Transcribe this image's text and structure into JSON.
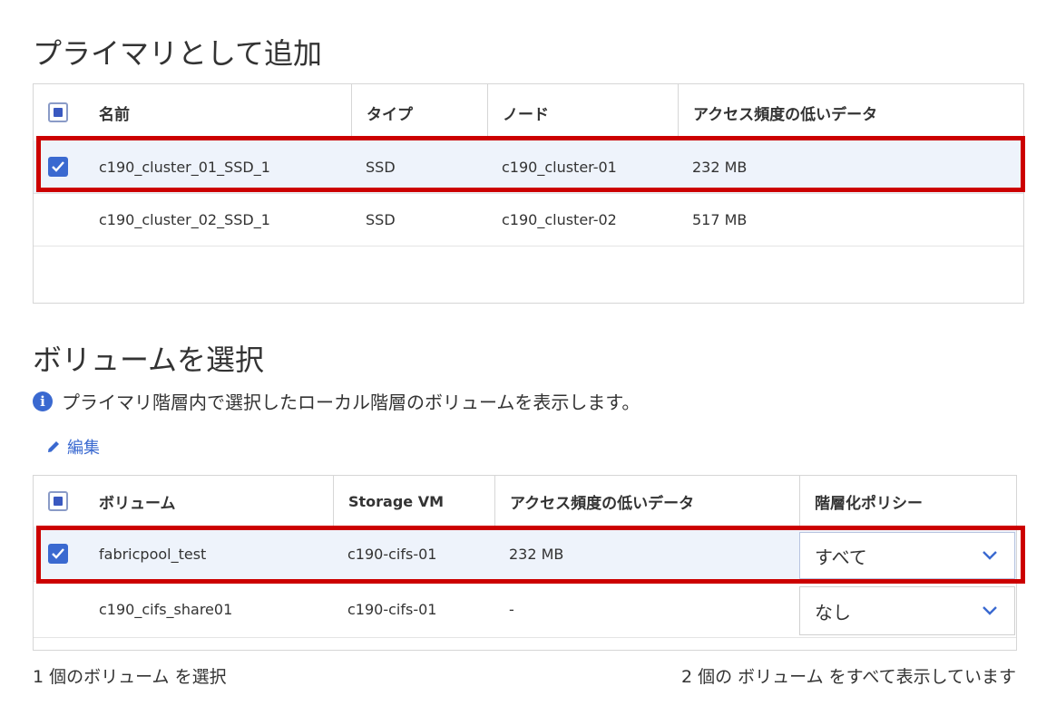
{
  "primary": {
    "title": "プライマリとして追加",
    "headers": {
      "name": "名前",
      "type": "タイプ",
      "node": "ノード",
      "cold": "アクセス頻度の低いデータ"
    },
    "rows": [
      {
        "name": "c190_cluster_01_SSD_1",
        "type": "SSD",
        "node": "c190_cluster-01",
        "cold": "232 MB"
      },
      {
        "name": "c190_cluster_02_SSD_1",
        "type": "SSD",
        "node": "c190_cluster-02",
        "cold": "517 MB"
      }
    ]
  },
  "volumes": {
    "title": "ボリュームを選択",
    "info": "プライマリ階層内で選択したローカル階層のボリュームを表示します。",
    "edit_label": "編集",
    "headers": {
      "volume": "ボリューム",
      "svm": "Storage VM",
      "cold": "アクセス頻度の低いデータ",
      "policy": "階層化ポリシー"
    },
    "rows": [
      {
        "volume": "fabricpool_test",
        "svm": "c190-cifs-01",
        "cold": "232 MB",
        "policy": "すべて"
      },
      {
        "volume": "c190_cifs_share01",
        "svm": "c190-cifs-01",
        "cold": "-",
        "policy": "なし"
      }
    ]
  },
  "footer": {
    "selected": "1 個のボリューム を選択",
    "shown": "2 個の ボリューム をすべて表示しています"
  },
  "colors": {
    "accent": "#3a69d0",
    "highlight": "#cc0000",
    "selected_row": "#eef3fb"
  }
}
